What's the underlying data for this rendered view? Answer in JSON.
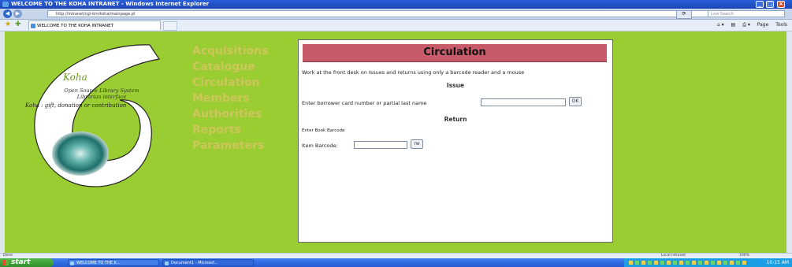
{
  "window": {
    "title": "WELCOME TO THE KOHA INTRANET - Windows Internet Explorer",
    "url": "http://intranet/cgi-bin/koha/mainpage.pl",
    "search_placeholder": "Live Search",
    "tab_title": "WELCOME TO THE KOHA INTRANET",
    "tools": [
      "Page",
      "Tools"
    ]
  },
  "logo": {
    "name": "Koha",
    "subtitle1": "Open Source Library System",
    "subtitle2": "Librarian interface",
    "tagline": "Koha : gift, donation or contribution"
  },
  "nav": {
    "items": [
      "Acquisitions",
      "Catalogue",
      "Circulation",
      "Members",
      "Authorities",
      "Reports",
      "Parameters"
    ]
  },
  "circulation": {
    "title": "Circulation",
    "intro": "Work at the front desk on Issues and returns using only a barcode reader and a mouse",
    "issue": {
      "heading": "Issue",
      "label": "Enter borrower card number or partial last name",
      "button": "OK"
    },
    "return": {
      "heading": "Return",
      "label": "Enter Book Barcode",
      "field_label": "Item Barcode:",
      "button": "rw"
    }
  },
  "statusbar": {
    "status": "Done",
    "zone": "Local intranet",
    "zoom": "100%"
  },
  "taskbar": {
    "start": "start",
    "tasks": [
      "WELCOME TO THE K...",
      "Document1 - Microsof..."
    ],
    "clock": "10:15 AM"
  }
}
